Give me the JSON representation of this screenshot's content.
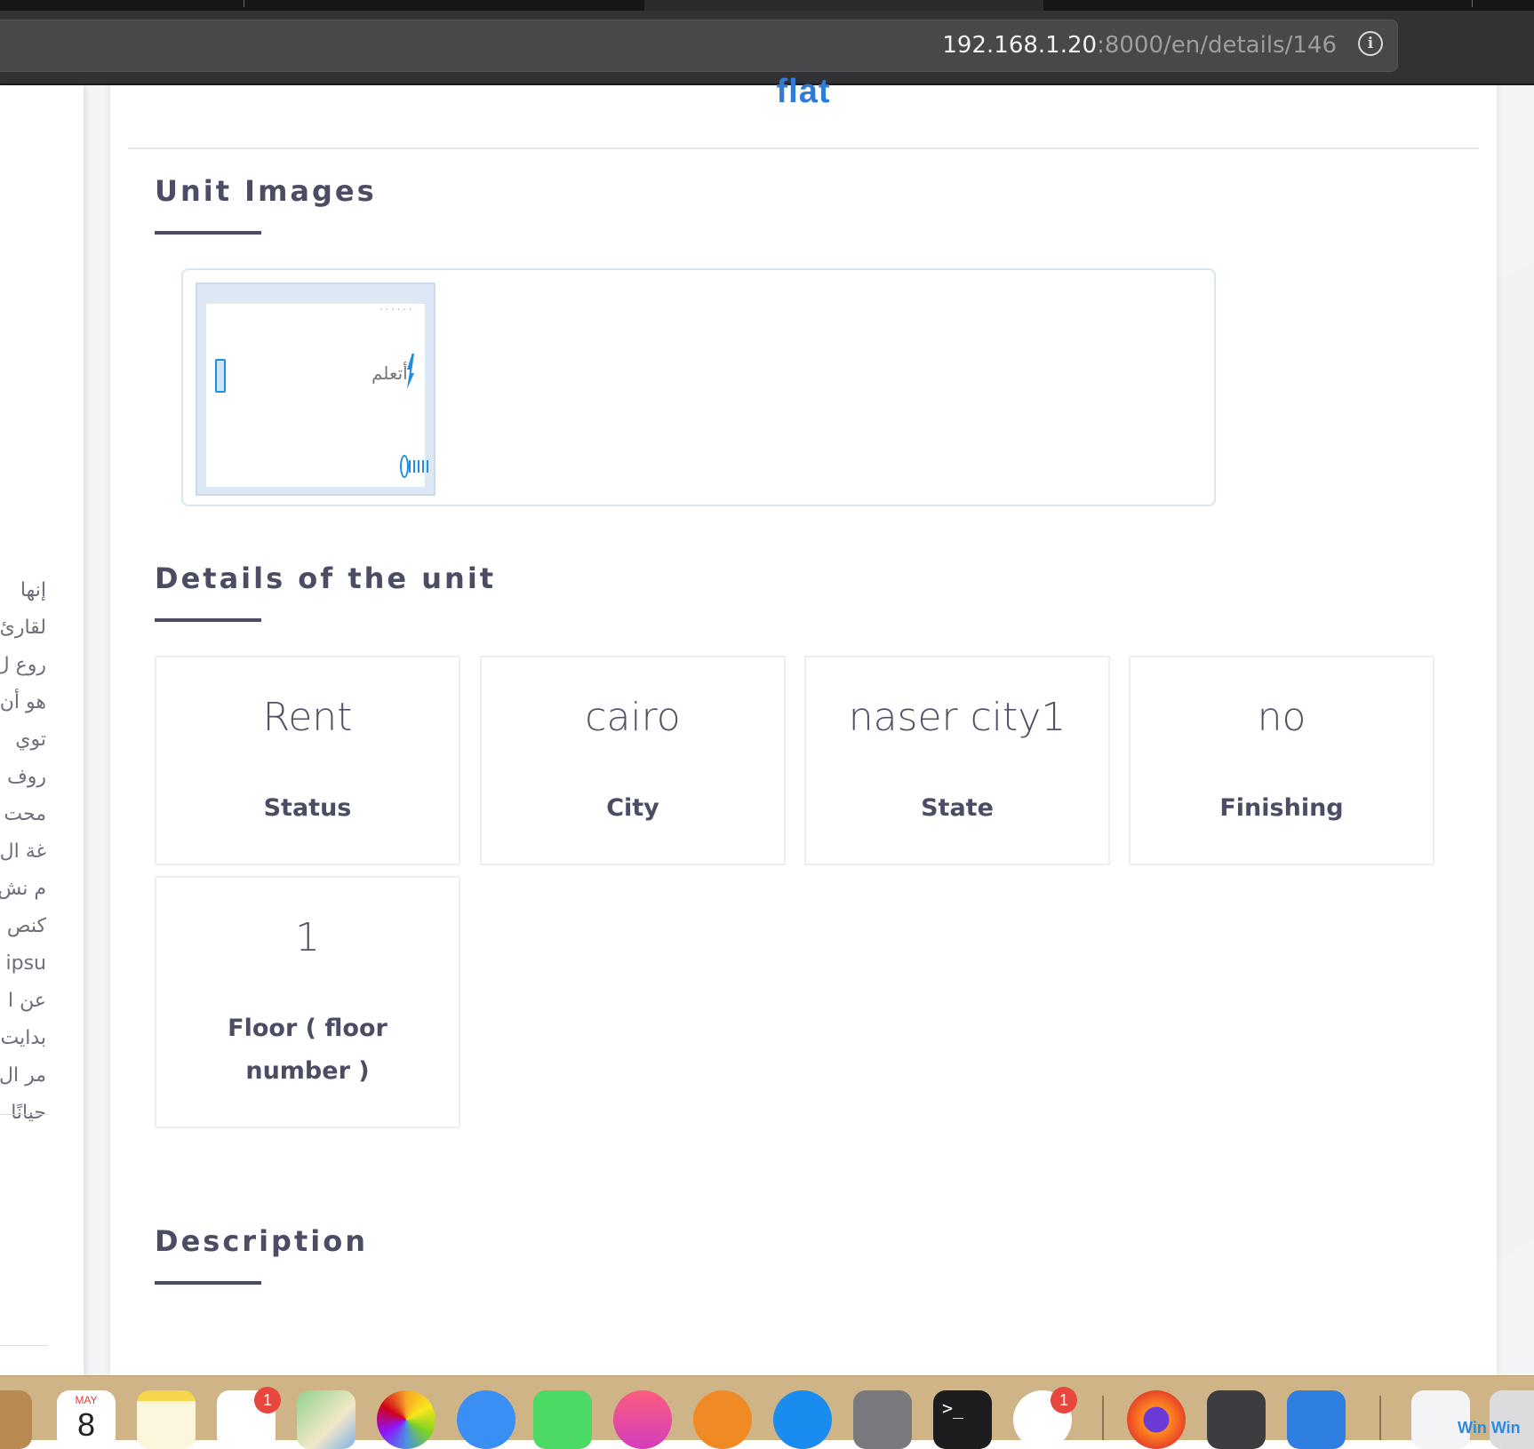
{
  "browser": {
    "url_host": "192.168.1.20",
    "url_path": ":8000/en/details/146",
    "info_icon": "info-icon"
  },
  "page": {
    "property_type": "flat",
    "sections": {
      "images_title": "Unit Images",
      "details_title": "Details of the unit",
      "description_title": "Description"
    },
    "thumbnail_text": "أتعلم",
    "details": [
      {
        "value": "Rent",
        "label": "Status"
      },
      {
        "value": "cairo",
        "label": "City"
      },
      {
        "value": "naser city1",
        "label": "State"
      },
      {
        "value": "no",
        "label": "Finishing"
      },
      {
        "value": "1",
        "label": "Floor ( floor number )"
      }
    ]
  },
  "sidebar": {
    "arabic_lines": [
      "إنها",
      "لقارئ",
      "روع ل",
      "هو أن",
      "توي",
      "روف",
      "محت",
      "غة ال",
      "م نش",
      "كنص",
      "ipsu",
      "عن ا",
      "بدايت",
      "مر ال",
      "حيانًا"
    ]
  },
  "dock": {
    "calendar_month": "MAY",
    "calendar_day": "8",
    "reminders_badge": "1",
    "slack_badge": "1",
    "terminal_prompt": ">_",
    "win_label": "Win Win",
    "icons": [
      "contacts-icon",
      "calendar-icon",
      "notes-icon",
      "reminders-icon",
      "maps-icon",
      "photos-icon",
      "messages-icon",
      "facetime-icon",
      "music-icon",
      "books-icon",
      "app-store-icon",
      "system-preferences-icon",
      "terminal-icon",
      "slack-icon",
      "firefox-icon",
      "sublime-text-icon",
      "xcode-icon",
      "document-icon",
      "trash-icon"
    ]
  }
}
